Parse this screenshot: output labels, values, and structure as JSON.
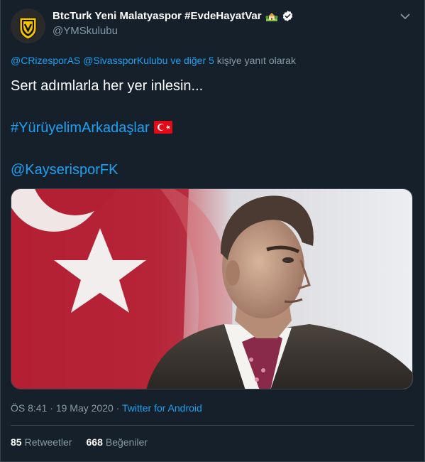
{
  "user": {
    "display_name": "BtcTurk Yeni Malatyaspor #EvdeHayatVar",
    "handle": "@YMSkulubu",
    "name_emoji": "house-with-garden",
    "verified": true
  },
  "reply": {
    "mention1": "@CRizesporAS",
    "mention2": "@SivassporKulubu",
    "and_others": "ve diğer 5",
    "suffix": "kişiye yanıt olarak"
  },
  "tweet": {
    "line1": "Sert adımlarla her yer inlesin...",
    "hashtag": "#YürüyelimArkadaşlar",
    "hashtag_emoji": "turkish-flag",
    "mention": "@KayserisporFK"
  },
  "meta": {
    "time": "ÖS 8:41",
    "sep1": "·",
    "date": "19 May 2020",
    "sep2": "·",
    "source": "Twitter for Android"
  },
  "stats": {
    "retweets_count": "85",
    "retweets_label": "Retweetler",
    "likes_count": "668",
    "likes_label": "Beğeniler"
  },
  "colors": {
    "background": "#15202b",
    "link": "#1da1f2",
    "secondary_text": "#8899a6",
    "border": "#38444d",
    "flag_red": "#e30a17"
  }
}
